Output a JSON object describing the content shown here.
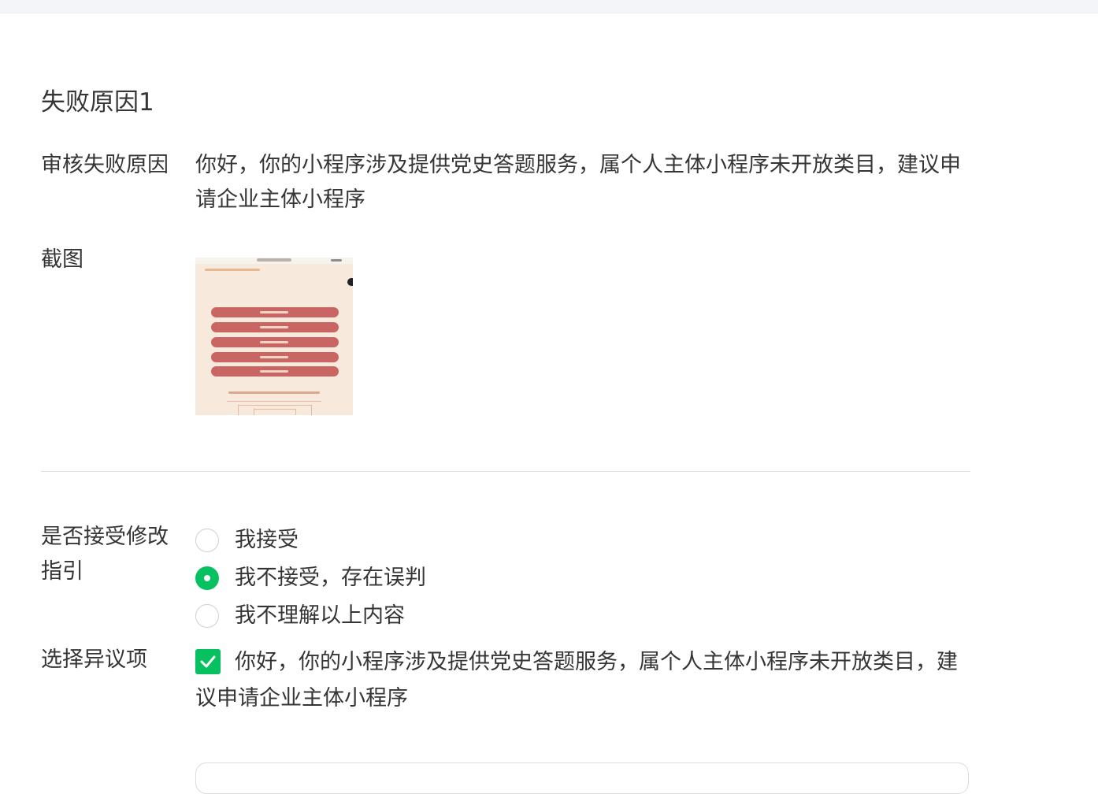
{
  "section": {
    "title": "失败原因1"
  },
  "reason": {
    "label": "审核失败原因",
    "text": "你好，你的小程序涉及提供党史答题服务，属个人主体小程序未开放类目，建议申请企业主体小程序"
  },
  "screenshot": {
    "label": "截图"
  },
  "accept": {
    "label": "是否接受修改指引",
    "options": [
      {
        "label": "我接受",
        "selected": false
      },
      {
        "label": "我不接受，存在误判",
        "selected": true
      },
      {
        "label": "我不理解以上内容",
        "selected": false
      }
    ]
  },
  "objection": {
    "label": "选择异议项",
    "items": [
      {
        "text": "你好，你的小程序涉及提供党史答题服务，属个人主体小程序未开放类目，建议申请企业主体小程序",
        "checked": true
      }
    ]
  },
  "colors": {
    "accent_green": "#07c160",
    "text": "#353535",
    "divider": "#e2e2e2"
  }
}
